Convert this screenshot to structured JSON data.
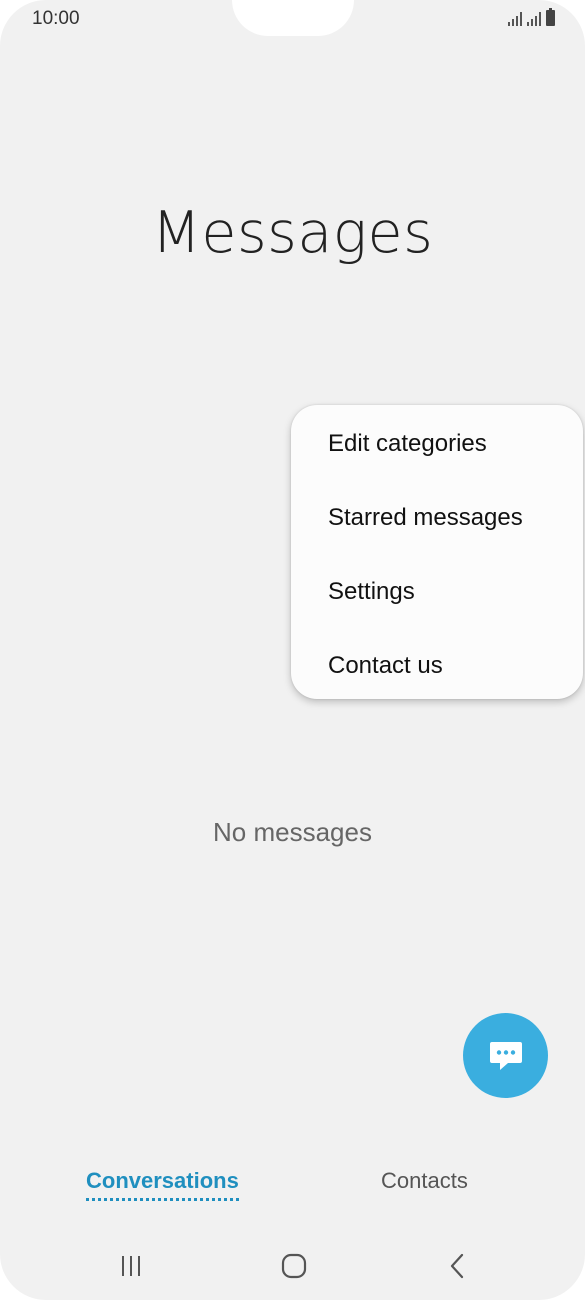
{
  "status_bar": {
    "time": "10:00",
    "icons": [
      "signal-sim1-icon",
      "signal-sim2-icon",
      "battery-icon"
    ]
  },
  "page": {
    "title": "Messages",
    "empty_text": "No messages"
  },
  "menu": {
    "items": [
      {
        "label": "Edit categories"
      },
      {
        "label": "Starred messages"
      },
      {
        "label": "Settings"
      },
      {
        "label": "Contact us"
      }
    ]
  },
  "fab": {
    "icon": "new-message-icon",
    "color": "#3aaedf"
  },
  "tabs": [
    {
      "label": "Conversations",
      "active": true
    },
    {
      "label": "Contacts",
      "active": false
    }
  ],
  "navigation": {
    "icons": [
      "recent-apps-icon",
      "home-icon",
      "back-icon"
    ]
  },
  "colors": {
    "accent": "#1f8fbf",
    "background": "#f1f1f1"
  }
}
